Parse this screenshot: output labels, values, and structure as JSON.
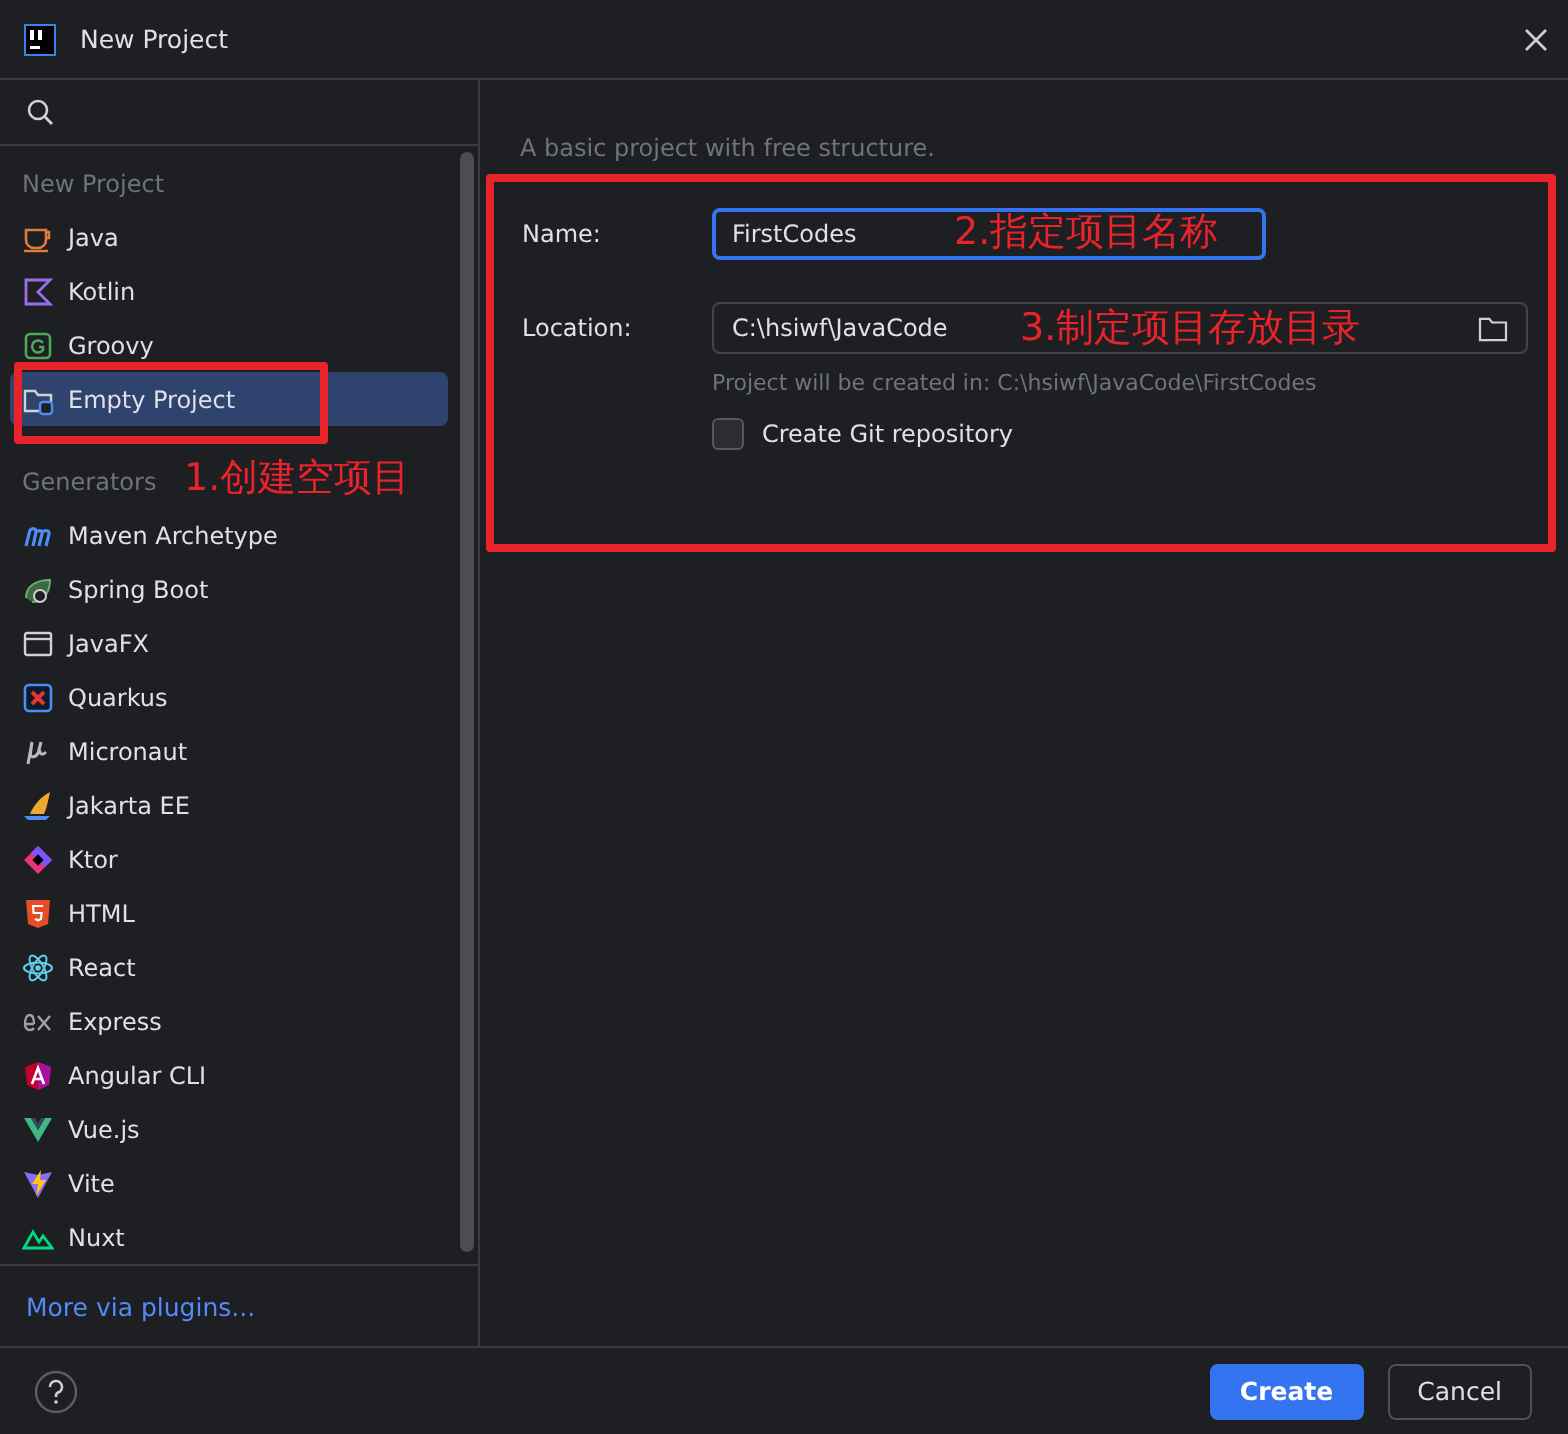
{
  "window": {
    "title": "New Project"
  },
  "sidebar": {
    "sections": [
      {
        "heading": "New Project",
        "items": [
          {
            "label": "Java",
            "kind": "cup",
            "selected": false
          },
          {
            "label": "Kotlin",
            "kind": "kotlin",
            "selected": false
          },
          {
            "label": "Groovy",
            "kind": "groovy",
            "selected": false
          },
          {
            "label": "Empty Project",
            "kind": "folder",
            "selected": true
          }
        ]
      },
      {
        "heading": "Generators",
        "items": [
          {
            "label": "Maven Archetype",
            "kind": "maven",
            "selected": false
          },
          {
            "label": "Spring Boot",
            "kind": "spring",
            "selected": false
          },
          {
            "label": "JavaFX",
            "kind": "window",
            "selected": false
          },
          {
            "label": "Quarkus",
            "kind": "quarkus",
            "selected": false
          },
          {
            "label": "Micronaut",
            "kind": "micronaut",
            "selected": false
          },
          {
            "label": "Jakarta EE",
            "kind": "sail",
            "selected": false
          },
          {
            "label": "Ktor",
            "kind": "ktor",
            "selected": false
          },
          {
            "label": "HTML",
            "kind": "html",
            "selected": false
          },
          {
            "label": "React",
            "kind": "atom",
            "selected": false
          },
          {
            "label": "Express",
            "kind": "express",
            "selected": false
          },
          {
            "label": "Angular CLI",
            "kind": "angular",
            "selected": false
          },
          {
            "label": "Vue.js",
            "kind": "vue",
            "selected": false
          },
          {
            "label": "Vite",
            "kind": "vite",
            "selected": false
          },
          {
            "label": "Nuxt",
            "kind": "nuxt",
            "selected": false
          }
        ]
      }
    ],
    "link": "More via plugins..."
  },
  "description": "A basic project with free structure.",
  "form": {
    "name": {
      "label": "Name:",
      "value": "FirstCodes",
      "focused": true
    },
    "location": {
      "label": "Location:",
      "value": "C:\\hsiwf\\JavaCode"
    },
    "hint": "Project will be created in: C:\\hsiwf\\JavaCode\\FirstCodes",
    "git": {
      "label": "Create Git repository",
      "checked": false
    }
  },
  "buttons": [
    {
      "label": "Create",
      "primary": true
    },
    {
      "label": "Cancel",
      "primary": false
    }
  ],
  "annotations": [
    {
      "text": "1.创建空项目"
    },
    {
      "text": "2.指定项目名称"
    },
    {
      "text": "3.制定项目存放目录"
    }
  ]
}
